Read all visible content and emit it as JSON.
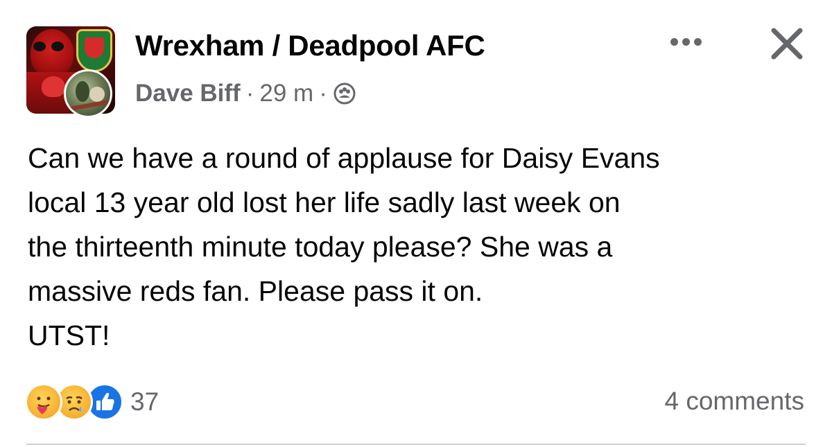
{
  "header": {
    "group_name": "Wrexham / Deadpool AFC",
    "author": "Dave Biff",
    "separator": "·",
    "time": "29 m",
    "privacy_icon": "group-members-icon",
    "more_icon": "more-options-icon",
    "close_icon": "close-icon"
  },
  "post": {
    "text": "Can we have a round of applause for Daisy Evans\nlocal 13 year old lost her life sadly last week on\nthe thirteenth minute today please? She was a\nmassive reds fan. Please pass it on.\nUTST!"
  },
  "footer": {
    "reactions": [
      "care-reaction-icon",
      "sad-reaction-icon",
      "like-reaction-icon"
    ],
    "reaction_count": "37",
    "comments": "4 comments"
  },
  "colors": {
    "text": "#050505",
    "secondary_text": "#65676b",
    "like_blue": "#1b74e4",
    "divider": "#ced0d4"
  }
}
